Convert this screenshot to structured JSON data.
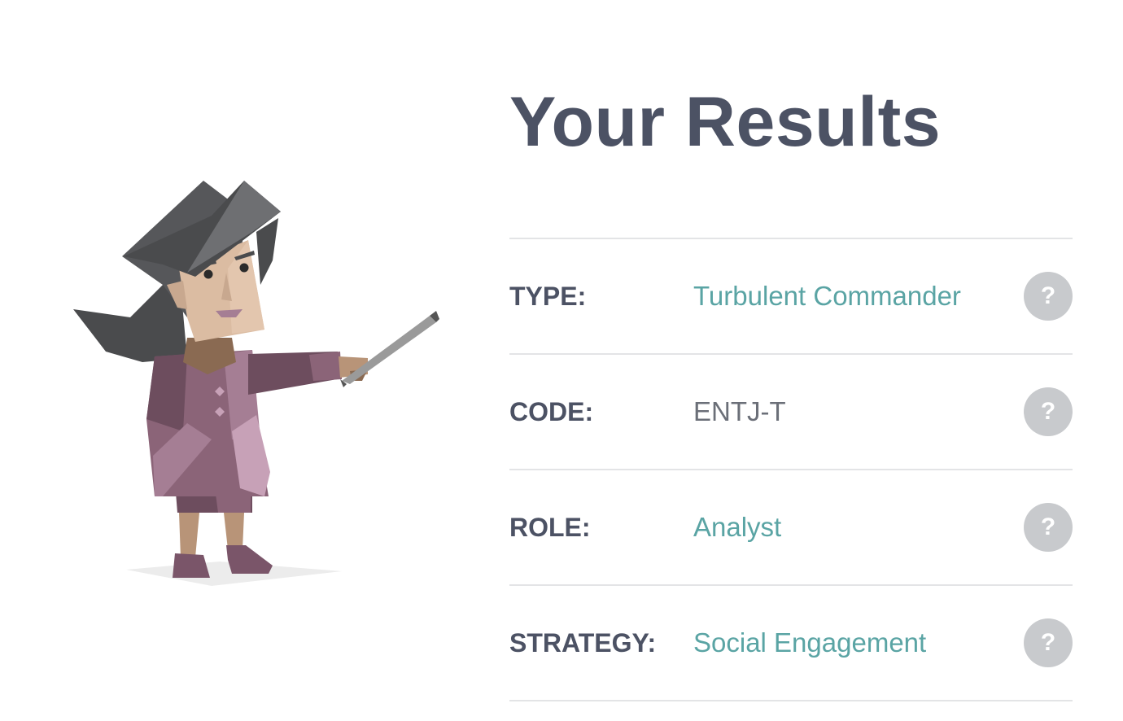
{
  "header": {
    "title": "Your Results"
  },
  "results": [
    {
      "label": "TYPE:",
      "value": "Turbulent Commander",
      "help": "?"
    },
    {
      "label": "CODE:",
      "value": "ENTJ-T",
      "help": "?"
    },
    {
      "label": "ROLE:",
      "value": "Analyst",
      "help": "?"
    },
    {
      "label": "STRATEGY:",
      "value": "Social Engagement",
      "help": "?"
    }
  ],
  "colors": {
    "heading": "#4c5264",
    "accent": "#5aa4a4",
    "muted": "#6b6f78",
    "divider": "#e3e4e6",
    "help_bg": "#c8cacd"
  },
  "illustration": {
    "icon": "commander-character-illustration"
  }
}
